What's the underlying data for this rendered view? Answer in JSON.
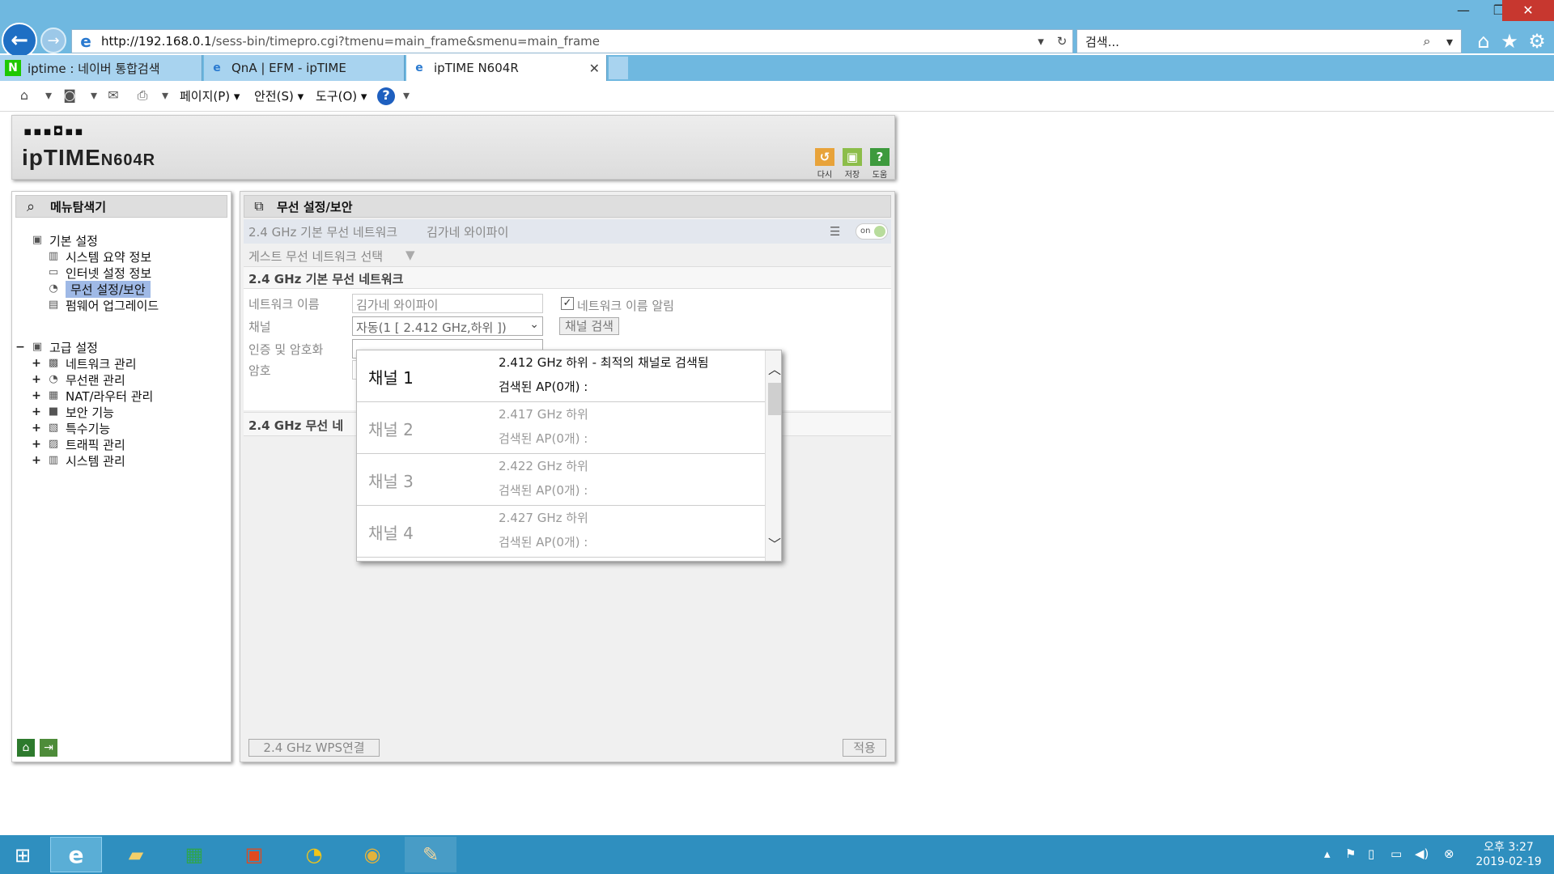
{
  "browser": {
    "url_host": "http://192.168.0.1",
    "url_path": "/sess-bin/timepro.cgi?tmenu=main_frame&smenu=main_frame",
    "search_placeholder": "검색...",
    "tabs": [
      {
        "label": "iptime : 네이버 통합검색",
        "icon": "naver-icon"
      },
      {
        "label": "QnA | EFM - ipTIME",
        "icon": "ie-icon"
      },
      {
        "label": "ipTIME N604R",
        "icon": "ie-icon",
        "active": true
      }
    ],
    "commands": {
      "page": "페이지(P)",
      "safety": "안전(S)",
      "tools": "도구(O)"
    }
  },
  "router": {
    "brand_logo": "ipTIME",
    "model": "N604R",
    "header_buttons": {
      "redo": "다시",
      "save": "저장",
      "help": "도움"
    },
    "menu_title": "메뉴탐색기",
    "basic_group": "기본 설정",
    "basic_items": [
      "시스템 요약 정보",
      "인터넷 설정 정보",
      "무선 설정/보안",
      "펌웨어 업그레이드"
    ],
    "advanced_group": "고급 설정",
    "advanced_items": [
      "네트워크 관리",
      "무선랜 관리",
      "NAT/라우터 관리",
      "보안 기능",
      "특수기능",
      "트래픽 관리",
      "시스템 관리"
    ],
    "main_title": "무선 설정/보안",
    "ssid_band_label": "2.4 GHz 기본 무선 네트워크",
    "ssid_band_value": "김가네 와이파이",
    "toggle_label": "on",
    "guest_select": "게스트 무선 네트워크 선택",
    "section_title": "2.4 GHz 기본 무선 네트워크",
    "section2_title": "2.4 GHz 무선 네",
    "form": {
      "name_label": "네트워크 이름",
      "name_value": "김가네 와이파이",
      "broadcast_label": "네트워크 이름 알림",
      "channel_label": "채널",
      "channel_value": "자동(1 [ 2.412 GHz,하위 ])",
      "channel_search_button": "채널 검색",
      "auth_label": "인증 및 암호화",
      "password_label": "암호"
    },
    "wps_button": "2.4 GHz WPS연결",
    "apply_button": "적용"
  },
  "channel_popup": {
    "items": [
      {
        "name": "채널 1",
        "freq": "2.412 GHz 하위 - 최적의 채널로 검색됨",
        "ap": "검색된 AP(0개) :"
      },
      {
        "name": "채널 2",
        "freq": "2.417 GHz 하위",
        "ap": "검색된 AP(0개) :"
      },
      {
        "name": "채널 3",
        "freq": "2.422 GHz 하위",
        "ap": "검색된 AP(0개) :"
      },
      {
        "name": "채널 4",
        "freq": "2.427 GHz 하위",
        "ap": "검색된 AP(0개) :"
      }
    ]
  },
  "taskbar": {
    "clock_time": "오후 3:27",
    "clock_date": "2019-02-19"
  },
  "colors": {
    "titlebar": "#6fb8e0",
    "taskbar": "#2f8fbf",
    "selected_menu": "#9fb9e6",
    "close_button": "#c7372f"
  }
}
